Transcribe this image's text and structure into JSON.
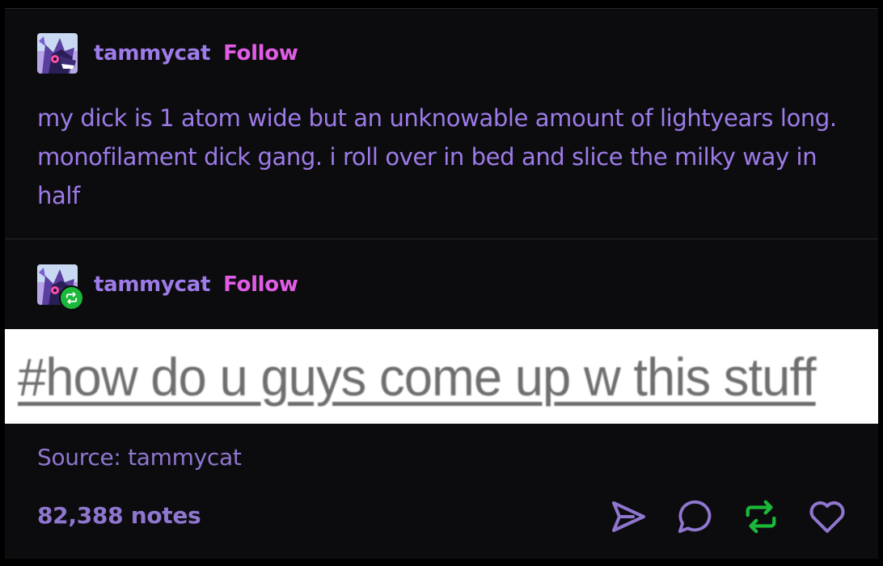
{
  "posts": [
    {
      "username": "tammycat",
      "follow_label": "Follow",
      "avatar_icon": "dragon-avatar-icon",
      "body": "my dick is 1 atom wide but an unknowable amount of lightyears long. monofilament dick gang. i roll over in bed and slice the milky way in half"
    },
    {
      "username": "tammycat",
      "follow_label": "Follow",
      "avatar_icon": "dragon-avatar-icon",
      "badge_icon": "reblog-badge-icon",
      "tag_image_text": "#how do u guys come up w this stuff"
    }
  ],
  "footer": {
    "source": "Source: tammycat",
    "notes": "82,388 notes",
    "actions": [
      "share-icon",
      "reply-icon",
      "reblog-icon",
      "like-icon"
    ]
  },
  "colors": {
    "background": "#0c0c0f",
    "text": "#9d7be8",
    "follow": "#e15ce5",
    "reblog": "#1bb83a",
    "muted": "#8f76cf"
  }
}
